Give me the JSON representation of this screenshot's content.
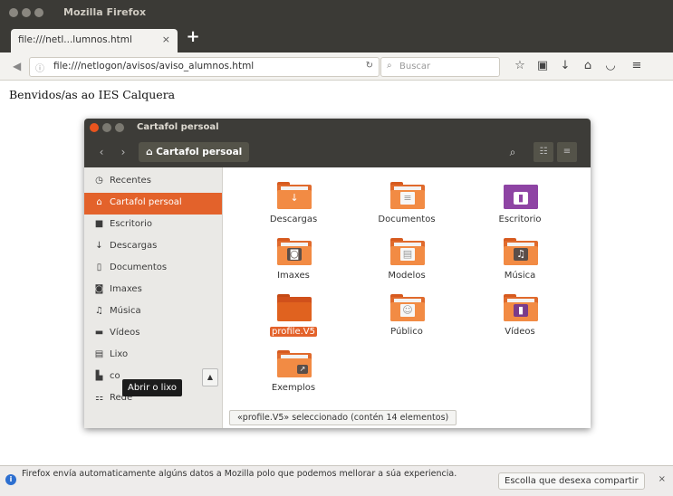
{
  "browser": {
    "window_title": "Mozilla Firefox",
    "tab_label": "file:///netl...lumnos.html",
    "tab_close": "×",
    "newtab": "+",
    "url": "file:///netlogon/avisos/aviso_alumnos.html",
    "search_placeholder": "Buscar",
    "icons": [
      "back-icon",
      "info-icon",
      "reload-icon",
      "search-icon",
      "bookmark-star-icon",
      "reader-icon",
      "download-icon",
      "home-icon",
      "pocket-icon",
      "menu-icon"
    ]
  },
  "page": {
    "welcome": "Benvidos/as ao IES Calquera"
  },
  "nautilus": {
    "title": "Cartafol persoal",
    "path": "Cartafol persoal",
    "sidebar": [
      {
        "label": "Recentes",
        "icon": "clock-icon",
        "glyph": "◷"
      },
      {
        "label": "Cartafol persoal",
        "icon": "home-icon",
        "glyph": "⌂"
      },
      {
        "label": "Escritorio",
        "icon": "folder-icon",
        "glyph": "■"
      },
      {
        "label": "Descargas",
        "icon": "download-icon",
        "glyph": "↓"
      },
      {
        "label": "Documentos",
        "icon": "document-icon",
        "glyph": "▯"
      },
      {
        "label": "Imaxes",
        "icon": "camera-icon",
        "glyph": "◙"
      },
      {
        "label": "Música",
        "icon": "music-icon",
        "glyph": "♫"
      },
      {
        "label": "Vídeos",
        "icon": "video-icon",
        "glyph": "▬"
      },
      {
        "label": "Lixo",
        "icon": "trash-icon",
        "glyph": "▤"
      },
      {
        "label": "co",
        "icon": "drive-icon",
        "glyph": "▙"
      },
      {
        "label": "Rede",
        "icon": "network-icon",
        "glyph": "⚏"
      }
    ],
    "selected_sidebar": "Cartafol persoal",
    "tooltip": "Abrir o lixo",
    "files": [
      {
        "name": "Descargas",
        "emblem": "download"
      },
      {
        "name": "Documentos",
        "emblem": "document"
      },
      {
        "name": "Escritorio",
        "emblem": "desktop"
      },
      {
        "name": "Imaxes",
        "emblem": "camera"
      },
      {
        "name": "Modelos",
        "emblem": "document"
      },
      {
        "name": "Música",
        "emblem": "music"
      },
      {
        "name": "profile.V5",
        "emblem": "none",
        "selected": true
      },
      {
        "name": "Público",
        "emblem": "person"
      },
      {
        "name": "Vídeos",
        "emblem": "video"
      },
      {
        "name": "Exemplos",
        "emblem": "link"
      }
    ],
    "status": "«profile.V5» seleccionado  (contén 14 elementos)"
  },
  "notification": {
    "text": "Firefox envía automaticamente algúns datos a Mozilla polo que podemos mellorar a súa experiencia.",
    "button": "Escolla que desexa compartir",
    "close": "×"
  },
  "colors": {
    "accent": "#e3622b",
    "folder": "#f28b44",
    "titlebar": "#3b3a36"
  }
}
